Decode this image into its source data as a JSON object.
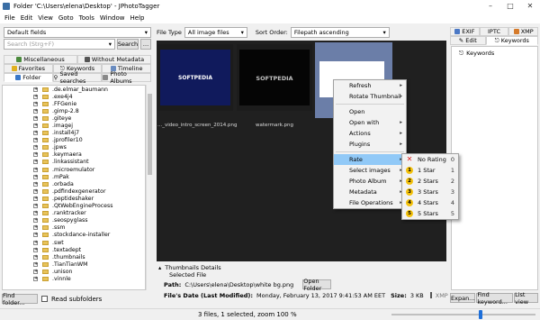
{
  "window": {
    "title": "Folder 'C:\\Users\\elena\\Desktop' - JPhotoTagger"
  },
  "menubar": [
    "File",
    "Edit",
    "View",
    "Goto",
    "Tools",
    "Window",
    "Help"
  ],
  "left": {
    "fields_combo": "Default fields",
    "search_placeholder": "Search (Strg+F)",
    "search_button": "Search",
    "tabs_row1": [
      "Miscellaneous",
      "Without Metadata"
    ],
    "tabs_row2": [
      "Favorites",
      "Keywords",
      "Timeline"
    ],
    "tabs_row3": [
      "Folder",
      "Saved searches",
      "Photo Albums"
    ],
    "tree": [
      ".de.elmar_baumann",
      ".exe4j4",
      ".FFGenie",
      ".gimp-2.8",
      ".giteye",
      ".imagej",
      ".install4j7",
      ".jprofiler10",
      ".jpws",
      ".keymaera",
      ".linkassistant",
      ".microemulator",
      ".mPak",
      ".orbada",
      ".pdfindexgenerator",
      ".peptideshaker",
      ".QtWebEngineProcess",
      ".ranktracker",
      ".seospyglass",
      ".ssm",
      ".stockdance-installer",
      ".swt",
      ".textadept",
      ".thumbnails",
      ".TianTianWM",
      ".unison",
      ".vinnle"
    ],
    "find_folder_button": "Find folder...",
    "read_subfolders_label": "Read subfolders"
  },
  "toolbar": {
    "file_type_label": "File Type",
    "file_type_value": "All image files",
    "sort_order_label": "Sort Order:",
    "sort_order_value": "Filepath ascending"
  },
  "thumbnails": [
    {
      "caption": "..._video_intro_screen_2014.png",
      "text": "SOFTPEDIA"
    },
    {
      "caption": "watermark.png",
      "text": "SOFTPEDIA"
    },
    {
      "caption": "white bg.png",
      "text": ""
    }
  ],
  "context_menu": {
    "items": [
      {
        "label": "Refresh",
        "submenu": true
      },
      {
        "label": "Rotate Thumbnail",
        "submenu": true
      },
      {
        "sep": true
      },
      {
        "label": "Open",
        "submenu": false
      },
      {
        "label": "Open with",
        "submenu": true
      },
      {
        "label": "Actions",
        "submenu": true
      },
      {
        "label": "Plugins",
        "submenu": true
      },
      {
        "sep": true
      },
      {
        "label": "Rate",
        "submenu": true,
        "highlighted": true
      },
      {
        "label": "Select images",
        "submenu": true
      },
      {
        "label": "Photo Album",
        "submenu": true
      },
      {
        "label": "Metadata",
        "submenu": true
      },
      {
        "label": "File Operations",
        "submenu": true
      }
    ]
  },
  "rate_submenu": [
    {
      "label": "No Rating",
      "key": "0",
      "icon": "x"
    },
    {
      "label": "1 Star",
      "key": "1",
      "icon": "1"
    },
    {
      "label": "2 Stars",
      "key": "2",
      "icon": "2"
    },
    {
      "label": "3 Stars",
      "key": "3",
      "icon": "3"
    },
    {
      "label": "4 Stars",
      "key": "4",
      "icon": "4"
    },
    {
      "label": "5 Stars",
      "key": "5",
      "icon": "5"
    }
  ],
  "details": {
    "header": "Thumbnails Details",
    "selected_label": "Selected File",
    "path_label": "Path:",
    "path_value": "C:\\Users\\elena\\Desktop\\white bg.png",
    "open_folder_button": "Open Folder",
    "date_label": "File's Date (Last Modified):",
    "date_value": "Monday, February 13, 2017 9:41:53 AM EET",
    "size_label": "Size:",
    "size_value": "3 KB",
    "xmp_label": "XMP sidecarfi..."
  },
  "status": {
    "text": "3 files, 1 selected, zoom 100 %",
    "zoom_percent": 62
  },
  "right": {
    "tabs_row1": [
      "EXIF",
      "IPTC",
      "XMP"
    ],
    "tabs_row2": [
      "Edit",
      "Keywords"
    ],
    "keywords_item": "Keywords",
    "expand_button": "Expan...",
    "find_keyword_button": "Find keyword...",
    "list_view_button": "List view"
  },
  "colors": {
    "highlight": "#91c9f7",
    "grid_bg": "#202020",
    "selected_cell": "#6b7ea8",
    "star": "#f4c20d"
  }
}
